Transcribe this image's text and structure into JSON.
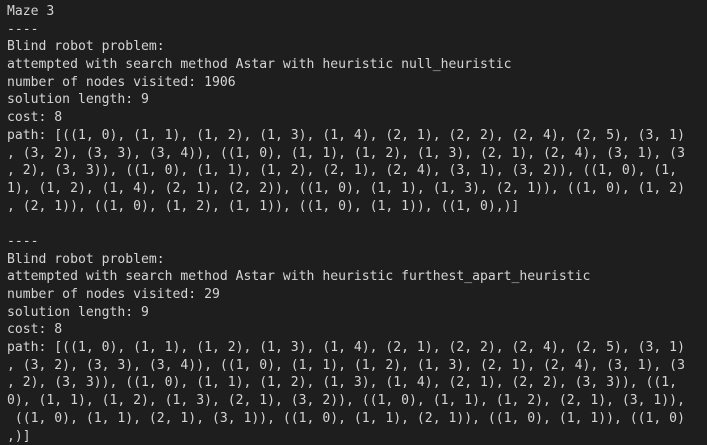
{
  "terminal": {
    "lines": [
      "Maze 3",
      "----",
      "Blind robot problem:",
      "attempted with search method Astar with heuristic null_heuristic",
      "number of nodes visited: 1906",
      "solution length: 9",
      "cost: 8",
      "path: [((1, 0), (1, 1), (1, 2), (1, 3), (1, 4), (2, 1), (2, 2), (2, 4), (2, 5), (3, 1)",
      ", (3, 2), (3, 3), (3, 4)), ((1, 0), (1, 1), (1, 2), (1, 3), (2, 1), (2, 4), (3, 1), (3",
      ", 2), (3, 3)), ((1, 0), (1, 1), (1, 2), (2, 1), (2, 4), (3, 1), (3, 2)), ((1, 0), (1,",
      "1), (1, 2), (1, 4), (2, 1), (2, 2)), ((1, 0), (1, 1), (1, 3), (2, 1)), ((1, 0), (1, 2)",
      ", (2, 1)), ((1, 0), (1, 2), (1, 1)), ((1, 0), (1, 1)), ((1, 0),)]",
      "",
      "----",
      "Blind robot problem:",
      "attempted with search method Astar with heuristic furthest_apart_heuristic",
      "number of nodes visited: 29",
      "solution length: 9",
      "cost: 8",
      "path: [((1, 0), (1, 1), (1, 2), (1, 3), (1, 4), (2, 1), (2, 2), (2, 4), (2, 5), (3, 1)",
      ", (3, 2), (3, 3), (3, 4)), ((1, 0), (1, 1), (1, 2), (1, 3), (2, 1), (2, 4), (3, 1), (3",
      ", 2), (3, 3)), ((1, 0), (1, 1), (1, 2), (1, 3), (1, 4), (2, 1), (2, 2), (3, 3)), ((1,",
      "0), (1, 1), (1, 2), (1, 3), (2, 1), (3, 2)), ((1, 0), (1, 1), (1, 2), (2, 1), (3, 1)),",
      " ((1, 0), (1, 1), (2, 1), (3, 1)), ((1, 0), (1, 1), (2, 1)), ((1, 0), (1, 1)), ((1, 0)",
      ",)]"
    ]
  }
}
